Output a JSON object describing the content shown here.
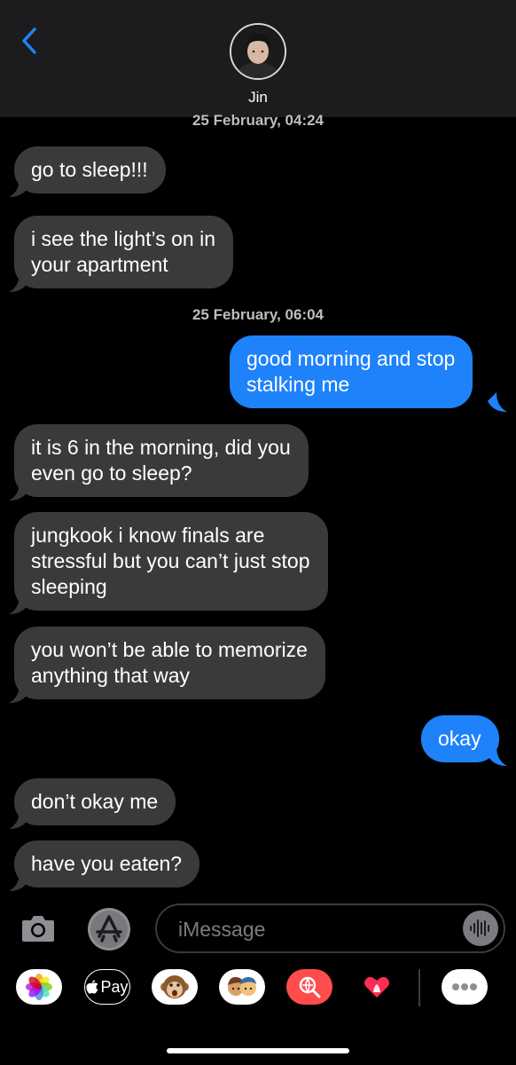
{
  "header": {
    "contact_name": "Jin"
  },
  "timestamps": [
    "25 February, 04:24",
    "25 February, 06:04"
  ],
  "messages": [
    {
      "direction": "in",
      "text": "go to sleep!!!"
    },
    {
      "direction": "in",
      "text": "i see the light’s on in\nyour apartment"
    },
    {
      "direction": "out",
      "text": "good morning and stop\nstalking me"
    },
    {
      "direction": "in",
      "text": "it is 6 in the morning, did you\neven go to sleep?"
    },
    {
      "direction": "in",
      "text": "jungkook i know finals are\nstressful but you can’t just stop\nsleeping"
    },
    {
      "direction": "in",
      "text": "you won’t be able to memorize\nanything that way"
    },
    {
      "direction": "out",
      "text": "okay"
    },
    {
      "direction": "in",
      "text": "don’t okay me"
    },
    {
      "direction": "in",
      "text": "have you eaten?"
    }
  ],
  "input": {
    "placeholder": "iMessage"
  },
  "app_drawer": {
    "items": [
      "photos-icon",
      "apple-pay-icon",
      "animoji-icon",
      "memoji-icon",
      "web-images-icon",
      "digital-touch-icon",
      "more-apps-icon"
    ],
    "apple_pay_label": "Pay"
  },
  "colors": {
    "incoming_bubble": "#3a3a3c",
    "outgoing_bubble": "#1e82fa",
    "accent": "#1e82fa"
  }
}
